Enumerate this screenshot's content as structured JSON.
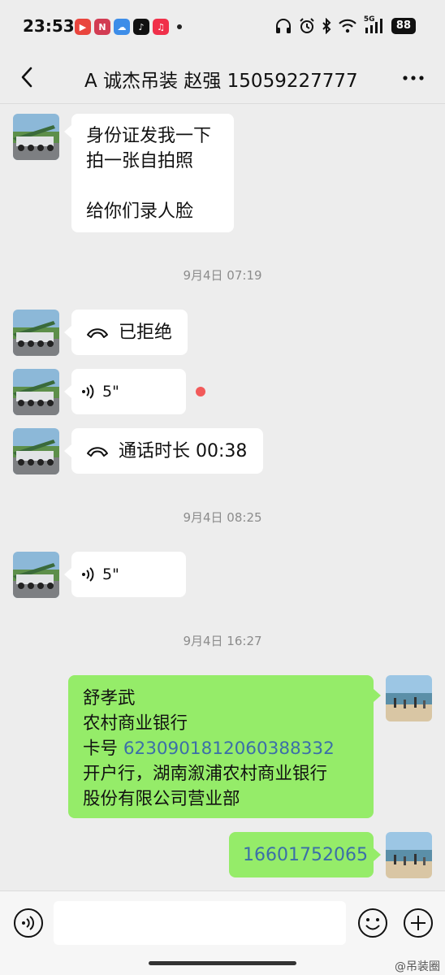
{
  "status": {
    "time": "23:53",
    "signal_label": "5G",
    "battery": "88",
    "app_icons": [
      "video-app-icon",
      "news-app-icon",
      "cloud-app-icon",
      "tiktok-icon",
      "music-app-icon"
    ]
  },
  "header": {
    "title": "A  诚杰吊装  赵强 15059227777"
  },
  "messages": {
    "m1": {
      "lines": [
        "身份证发我一下",
        "拍一张自拍照",
        "",
        "给你们录人脸"
      ]
    },
    "ts1": "9月4日 07:19",
    "m2": {
      "text": "已拒绝"
    },
    "m3": {
      "duration": "5\""
    },
    "m4": {
      "text": "通话时长 00:38"
    },
    "ts2": "9月4日 08:25",
    "m5": {
      "duration": "5\""
    },
    "ts3": "9月4日 16:27",
    "m6": {
      "line1": "舒孝武",
      "line2": "农村商业银行",
      "line3_prefix": "卡号 ",
      "line3_number": "6230901812060388332",
      "line4": "开户行，湖南溆浦农村商业银行",
      "line5": "股份有限公司营业部"
    },
    "m7": {
      "text": "16601752065"
    }
  },
  "watermark": "@吊装圈",
  "colors": {
    "background": "#ededed",
    "incoming_bubble": "#ffffff",
    "outgoing_bubble": "#95ec69",
    "link": "#3b6fa8",
    "unread_dot": "#f25a5a"
  }
}
